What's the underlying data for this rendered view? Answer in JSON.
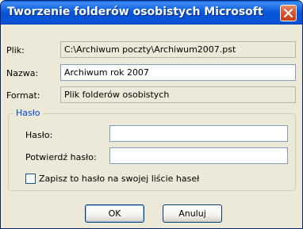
{
  "window": {
    "title": "Tworzenie folderów osobistych Microsoft"
  },
  "file": {
    "label": "Plik:",
    "value": "C:\\Archiwum poczty\\Archiwum2007.pst"
  },
  "name": {
    "label": "Nazwa:",
    "value": "Archiwum rok 2007"
  },
  "format": {
    "label": "Format:",
    "value": "Plik folderów osobistych"
  },
  "password_group": {
    "legend": "Hasło",
    "password_label": "Hasło:",
    "password_value": "",
    "confirm_label": "Potwierdź hasło:",
    "confirm_value": "",
    "save_checkbox_label": "Zapisz to hasło na swojej liście haseł",
    "save_checked": false
  },
  "buttons": {
    "ok": "OK",
    "cancel": "Anuluj"
  },
  "colors": {
    "titlebar": "#0a5ee0",
    "close": "#d95a35",
    "dialog_bg": "#ece9d8",
    "group_legend": "#0046d5"
  }
}
